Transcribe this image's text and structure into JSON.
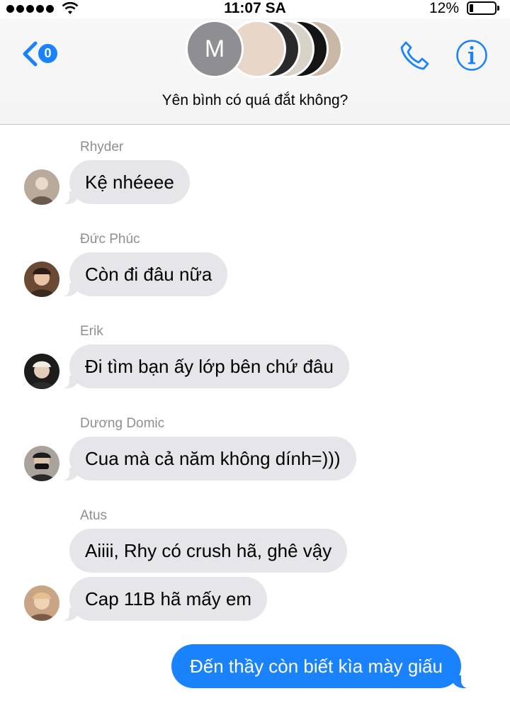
{
  "status_bar": {
    "time": "11:07 SA",
    "battery": "12%"
  },
  "header": {
    "back_count": "0",
    "group_initial": "M",
    "group_name": "Yên bình có quá đắt không?"
  },
  "messages": [
    {
      "sender": "Rhyder",
      "texts": [
        "Kệ nhéeee"
      ]
    },
    {
      "sender": "Đức Phúc",
      "texts": [
        "Còn đi đâu nữa"
      ]
    },
    {
      "sender": "Erik",
      "texts": [
        "Đi tìm bạn ấy lớp bên chứ đâu"
      ]
    },
    {
      "sender": "Dương Domic",
      "texts": [
        "Cua mà cả năm không dính=)))"
      ]
    },
    {
      "sender": "Atus",
      "texts": [
        "Aiiii, Rhy có crush hã, ghê vậy",
        "Cap 11B hã mấy em"
      ]
    }
  ],
  "outgoing": {
    "text": "Đến thầy còn biết kìa mày giấu"
  },
  "colors": {
    "accent": "#1982fc",
    "incoming_bubble": "#e5e5ea",
    "sender_name": "#8e8e93"
  }
}
